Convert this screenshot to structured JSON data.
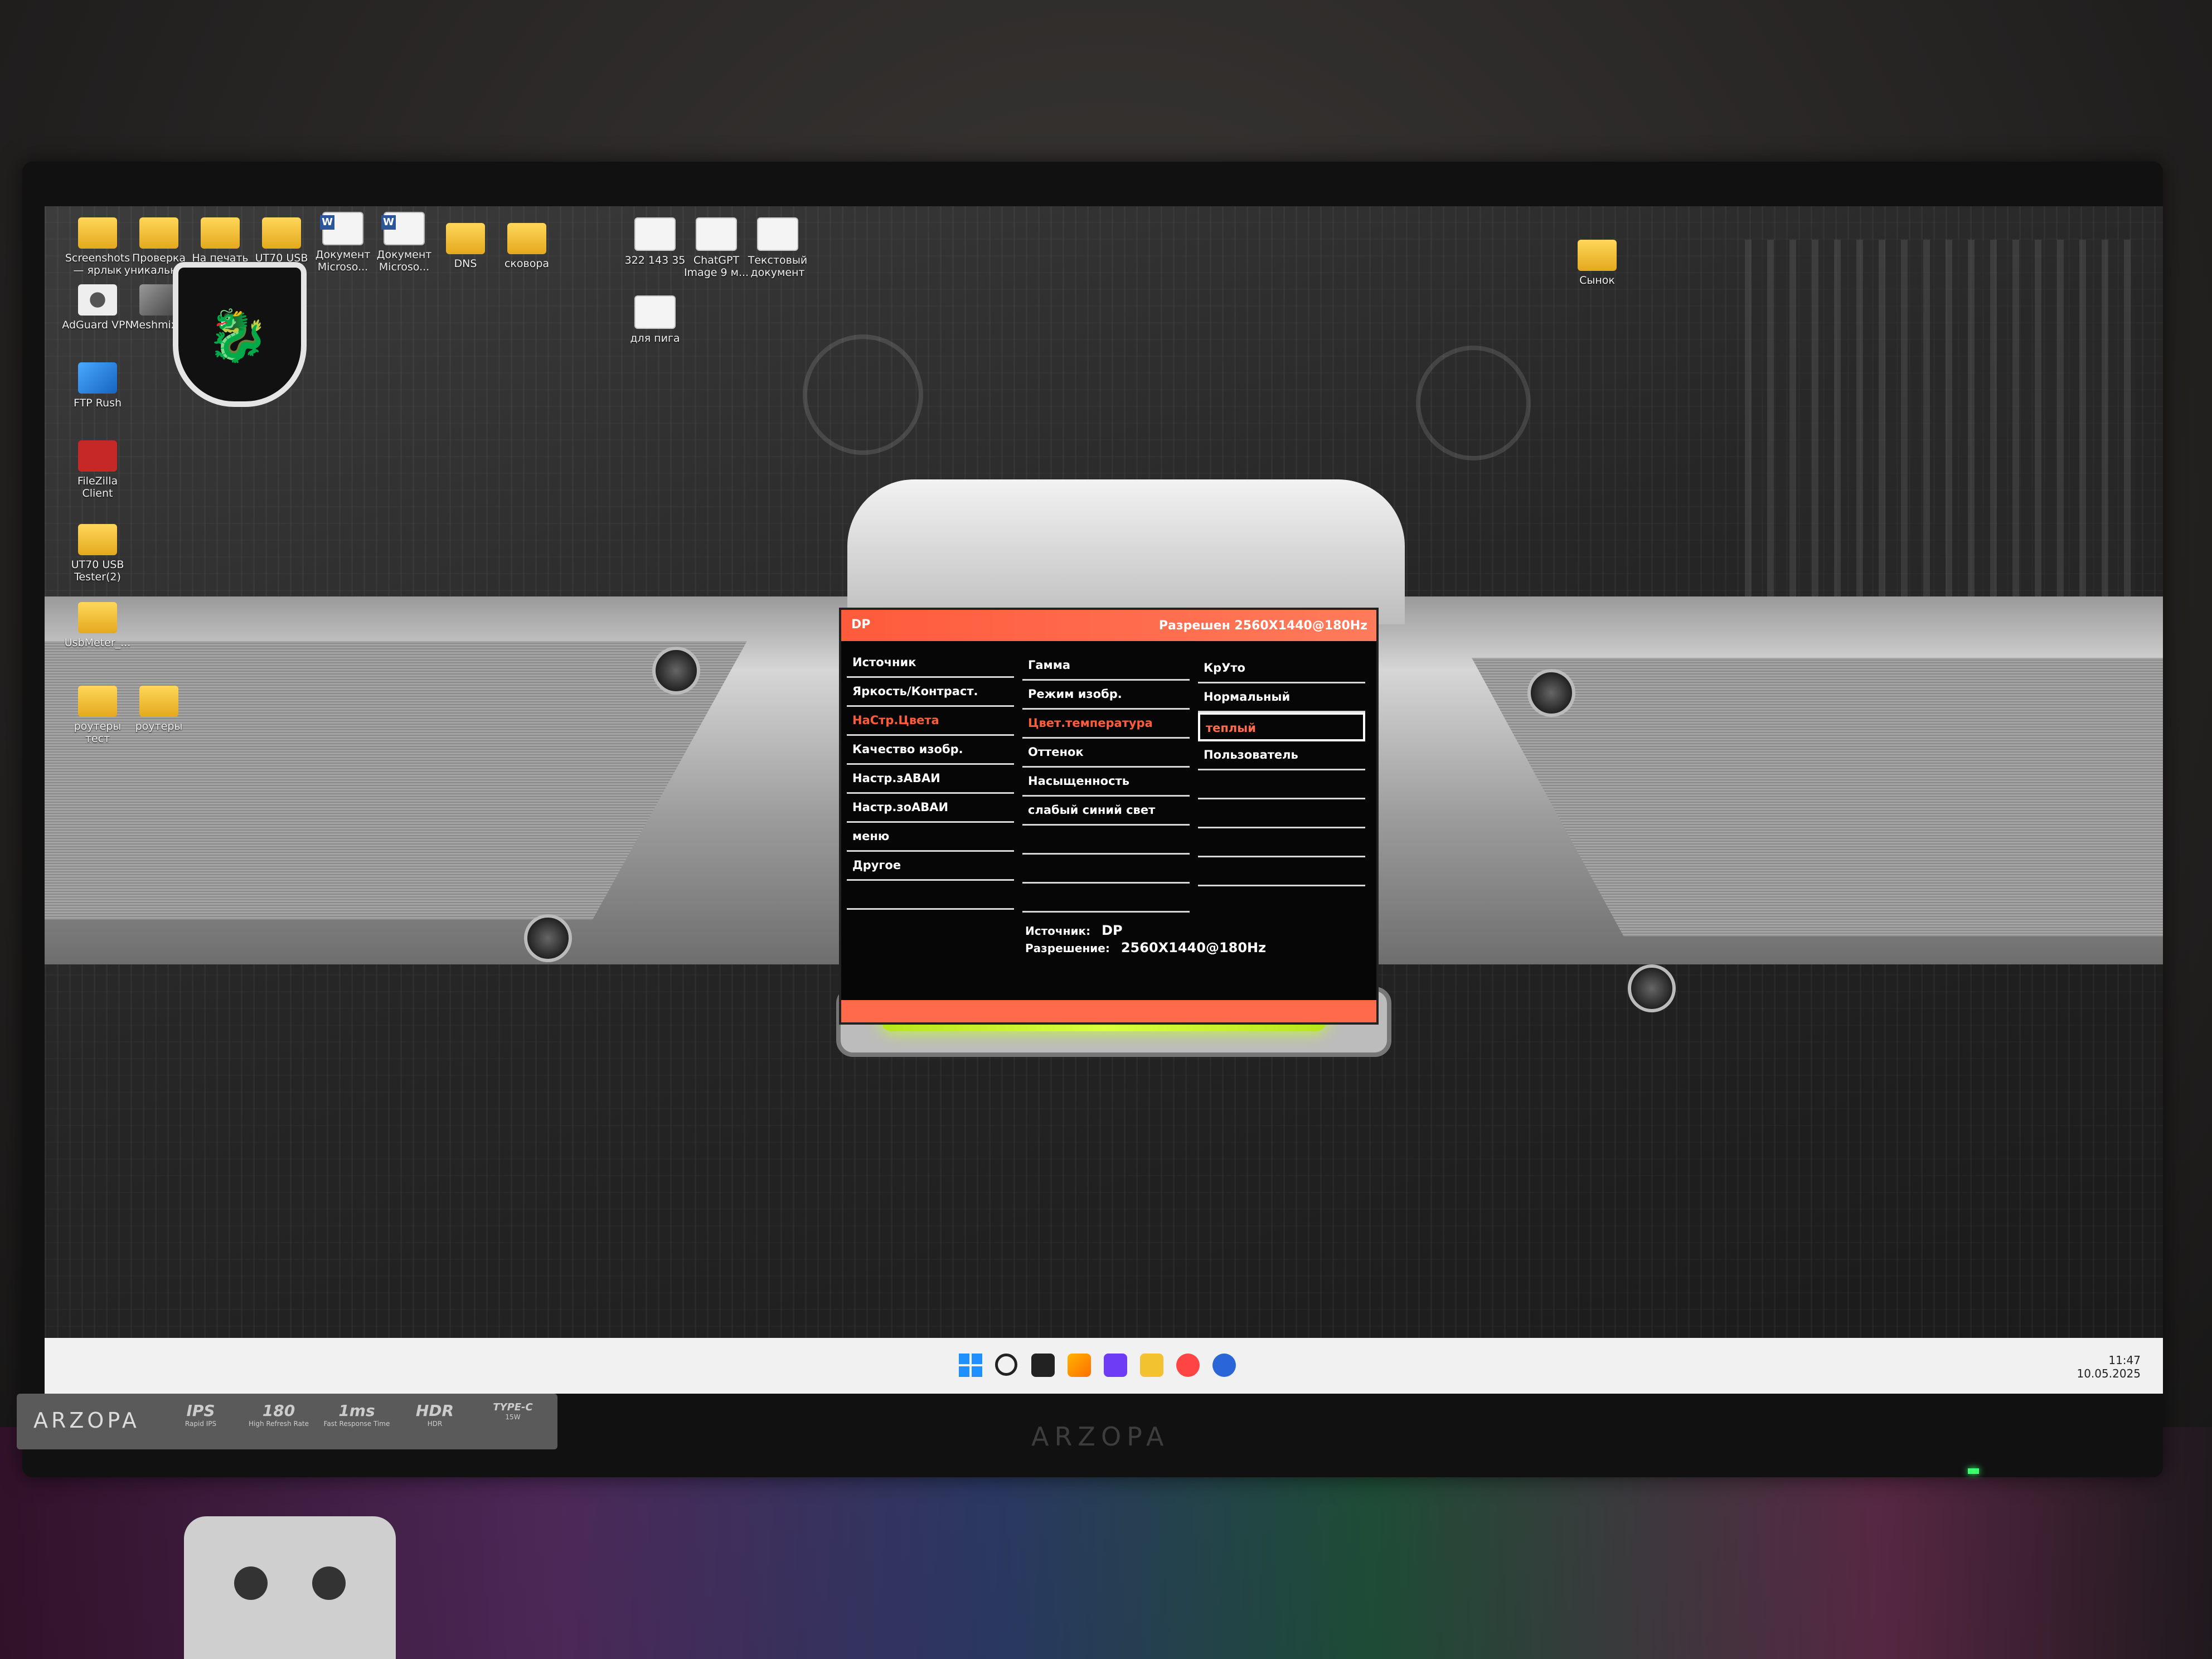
{
  "desktop": {
    "icons": [
      {
        "label": "Screenshots — ярлык",
        "type": "folder"
      },
      {
        "label": "Проверка уникально...",
        "type": "folder"
      },
      {
        "label": "На печать",
        "type": "folder"
      },
      {
        "label": "UT70 USB Tester(2)",
        "type": "folder"
      },
      {
        "label": "Документ Microso...",
        "type": "word"
      },
      {
        "label": "Документ Microso...",
        "type": "word"
      },
      {
        "label": "DNS",
        "type": "folder"
      },
      {
        "label": "сковора",
        "type": "folder"
      },
      {
        "label": "322 143 35",
        "type": "doc"
      },
      {
        "label": "ChatGPT Image 9 м...",
        "type": "doc"
      },
      {
        "label": "Текстовый документ",
        "type": "doc"
      },
      {
        "label": "для пига",
        "type": "doc"
      },
      {
        "label": "Сынок",
        "type": "folder"
      },
      {
        "label": "AdGuard VPN",
        "type": "app"
      },
      {
        "label": "Meshmixer",
        "type": "app"
      },
      {
        "label": "FTP Rush",
        "type": "app"
      },
      {
        "label": "FileZilla Client",
        "type": "app"
      },
      {
        "label": "UT70 USB Tester(2)",
        "type": "folder"
      },
      {
        "label": "UsbMeter_...",
        "type": "folder"
      },
      {
        "label": "роутеры тест",
        "type": "folder"
      },
      {
        "label": "роутеры",
        "type": "folder"
      }
    ]
  },
  "osd": {
    "source": "DP",
    "header_resolution": "Разрешен 2560X1440@180Hz",
    "menu_col1": [
      "Источник",
      "Яркость/Контраст.",
      "НаСтр.Цвета",
      "Качество изобр.",
      "Настр.зАВАИ",
      "Настр.зоАВАИ",
      "меню",
      "Другое"
    ],
    "menu_col2": [
      "Гамма",
      "Режим изобр.",
      "Цвет.температура",
      "Оттенок",
      "Насыщенность",
      "слабый синий свет"
    ],
    "menu_col3": [
      "КрУто",
      "Нормальный",
      "теплый",
      "Пользователь"
    ],
    "info_source_label": "Источник:",
    "info_source_value": "DP",
    "info_res_label": "Разрешение:",
    "info_res_value": "2560X1440@180Hz"
  },
  "taskbar": {
    "time": "11:47",
    "date": "10.05.2025"
  },
  "bezel": {
    "brand": "ARZOPA",
    "features": [
      {
        "big": "IPS",
        "small": "Rapid IPS"
      },
      {
        "big": "180",
        "small": "High Refresh Rate"
      },
      {
        "big": "1ms",
        "small": "Fast Response Time"
      },
      {
        "big": "HDR",
        "small": "HDR"
      },
      {
        "big": "TYPE-C",
        "small": "15W"
      }
    ],
    "bottom_logo": "ARZOPA"
  }
}
